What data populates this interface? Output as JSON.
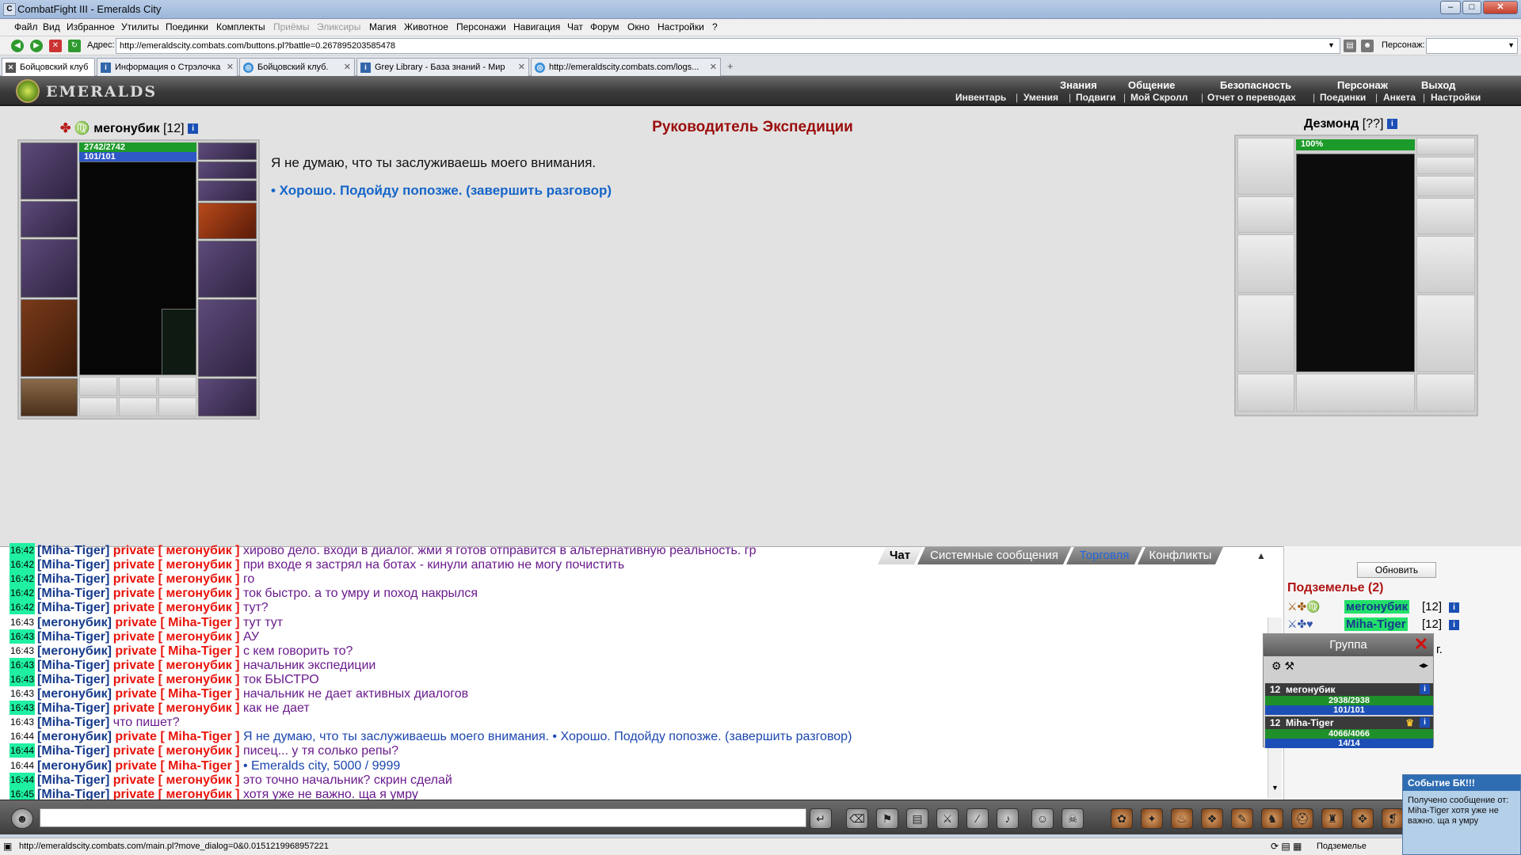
{
  "window": {
    "title": "CombatFight III - Emeralds City"
  },
  "menu": [
    "Файл",
    "Вид",
    "Избранное",
    "Утилиты",
    "Поединки",
    "Комплекты",
    "Приёмы",
    "Эликсиры",
    "Магия",
    "Животное",
    "Персонажи",
    "Навигация",
    "Чат",
    "Форум",
    "Окно",
    "Настройки",
    "?"
  ],
  "address": {
    "label": "Адрес:",
    "url": "http://emeraldscity.combats.com/buttons.pl?battle=0.267895203585478",
    "persona_label": "Персонаж:"
  },
  "tabs": [
    {
      "label": "Бойцовский клуб"
    },
    {
      "label": "Информация о Стрэлочка"
    },
    {
      "label": "Бойцовский клуб."
    },
    {
      "label": "Grey Library - База знаний - Мир"
    },
    {
      "label": "http://emeraldscity.combats.com/logs..."
    }
  ],
  "game_nav": {
    "logo": "EMERALDS",
    "top": [
      "Знания",
      "Общение",
      "Безопасность",
      "Персонаж",
      "Выход"
    ],
    "sub": [
      "Инвентарь",
      "Умения",
      "Подвиги",
      "Мой Скролл",
      "Отчет о переводах",
      "Поединки",
      "Анкета",
      "Настройки"
    ],
    "separator": "|"
  },
  "player": {
    "name": "мегонубик",
    "level": "[12]",
    "hp": "2742/2742",
    "mp": "101/101",
    "info": "i"
  },
  "npc": {
    "name": "Дезмонд",
    "level": "[??]",
    "hp": "100%",
    "info": "i"
  },
  "dialog": {
    "title": "Руководитель Экспедиции",
    "text": "Я не думаю, что ты заслуживаешь моего внимания.",
    "answer": "• Хорошо. Подойду попозже. (завершить разговор)"
  },
  "chat_tabs": [
    "Чат",
    "Системные сообщения",
    "Торговля",
    "Конфликты"
  ],
  "chat": [
    {
      "time": "16:42",
      "hl": true,
      "from": "Miha-Tiger",
      "to": "мегонубик",
      "text": "хирово дело. входи в диалог. жми я готов отправится в альтернативную реальность. гр",
      "cls": "msg-purple"
    },
    {
      "time": "16:42",
      "hl": true,
      "from": "Miha-Tiger",
      "to": "мегонубик",
      "text": "при входе я застрял на ботах - кинули апатию не могу почистить",
      "cls": "msg-purple"
    },
    {
      "time": "16:42",
      "hl": true,
      "from": "Miha-Tiger",
      "to": "мегонубик",
      "text": "го",
      "cls": "msg-purple"
    },
    {
      "time": "16:42",
      "hl": true,
      "from": "Miha-Tiger",
      "to": "мегонубик",
      "text": "ток быстро. а то умру и поход накрылся",
      "cls": "msg-purple"
    },
    {
      "time": "16:42",
      "hl": true,
      "from": "Miha-Tiger",
      "to": "мегонубик",
      "text": "тут?",
      "cls": "msg-purple"
    },
    {
      "time": "16:43",
      "hl": false,
      "from": "мегонубик",
      "to": "Miha-Tiger",
      "text": "тут тут",
      "cls": "msg-purple"
    },
    {
      "time": "16:43",
      "hl": true,
      "from": "Miha-Tiger",
      "to": "мегонубик",
      "text": "АУ",
      "cls": "msg-purple"
    },
    {
      "time": "16:43",
      "hl": false,
      "from": "мегонубик",
      "to": "Miha-Tiger",
      "text": "с кем говорить то?",
      "cls": "msg-purple"
    },
    {
      "time": "16:43",
      "hl": true,
      "from": "Miha-Tiger",
      "to": "мегонубик",
      "text": "начальник экспедиции",
      "cls": "msg-purple"
    },
    {
      "time": "16:43",
      "hl": true,
      "from": "Miha-Tiger",
      "to": "мегонубик",
      "text": "ток БЫСТРО",
      "cls": "msg-purple"
    },
    {
      "time": "16:43",
      "hl": false,
      "from": "мегонубик",
      "to": "Miha-Tiger",
      "text": "начальник не дает активных диалогов",
      "cls": "msg-purple"
    },
    {
      "time": "16:43",
      "hl": true,
      "from": "Miha-Tiger",
      "to": "мегонубик",
      "text": "как не дает",
      "cls": "msg-purple"
    },
    {
      "time": "16:43",
      "hl": false,
      "from": "Miha-Tiger",
      "to": "",
      "text": "что пишет?",
      "cls": "msg-purple"
    },
    {
      "time": "16:44",
      "hl": false,
      "from": "мегонубик",
      "to": "Miha-Tiger",
      "text": "Я не думаю, что ты заслуживаешь моего внимания. • Хорошо. Подойду попозже. (завершить разговор)",
      "cls": "msg-blue"
    },
    {
      "time": "16:44",
      "hl": true,
      "from": "Miha-Tiger",
      "to": "мегонубик",
      "text": "писец... у тя солько репы?",
      "cls": "msg-purple"
    },
    {
      "time": "16:44",
      "hl": false,
      "from": "мегонубик",
      "to": "Miha-Tiger",
      "text": "• Emeralds city, 5000 / 9999",
      "cls": "msg-blue"
    },
    {
      "time": "16:44",
      "hl": true,
      "from": "Miha-Tiger",
      "to": "мегонубик",
      "text": "это точно начальник? скрин сделай",
      "cls": "msg-purple"
    },
    {
      "time": "16:45",
      "hl": true,
      "from": "Miha-Tiger",
      "to": "мегонубик",
      "text": "хотя уже не важно. ща я умру",
      "cls": "msg-purple"
    }
  ],
  "chat_words": {
    "private": "private",
    "open": "[",
    "close": "]"
  },
  "online": {
    "refresh": "Обновить",
    "location": "Подземелье (2)",
    "users": [
      {
        "name": "мегонубик",
        "level": "[12]"
      },
      {
        "name": "Miha-Tiger",
        "level": "[12]"
      }
    ],
    "clipped_text": "г."
  },
  "group": {
    "title": "Группа",
    "members": [
      {
        "level": "12",
        "name": "мегонубик",
        "hp": "2938/2938",
        "mp": "101/101"
      },
      {
        "level": "12",
        "name": "Miha-Tiger",
        "hp": "4066/4066",
        "mp": "14/14"
      }
    ]
  },
  "status": {
    "url": "http://emeraldscity.combats.com/main.pl?move_dialog=0&0.0151219968957221",
    "location": "Подземелье"
  },
  "notification": {
    "title": "Событие БК!!!",
    "body": "Получено сообщение от: Miha-Tiger хотя уже не важно. ща я умру"
  },
  "colors": {
    "accent": "#9c0d0d",
    "link": "#1565c8",
    "private": "#e8140c",
    "timestamp_bg": "#1ff0a1"
  }
}
